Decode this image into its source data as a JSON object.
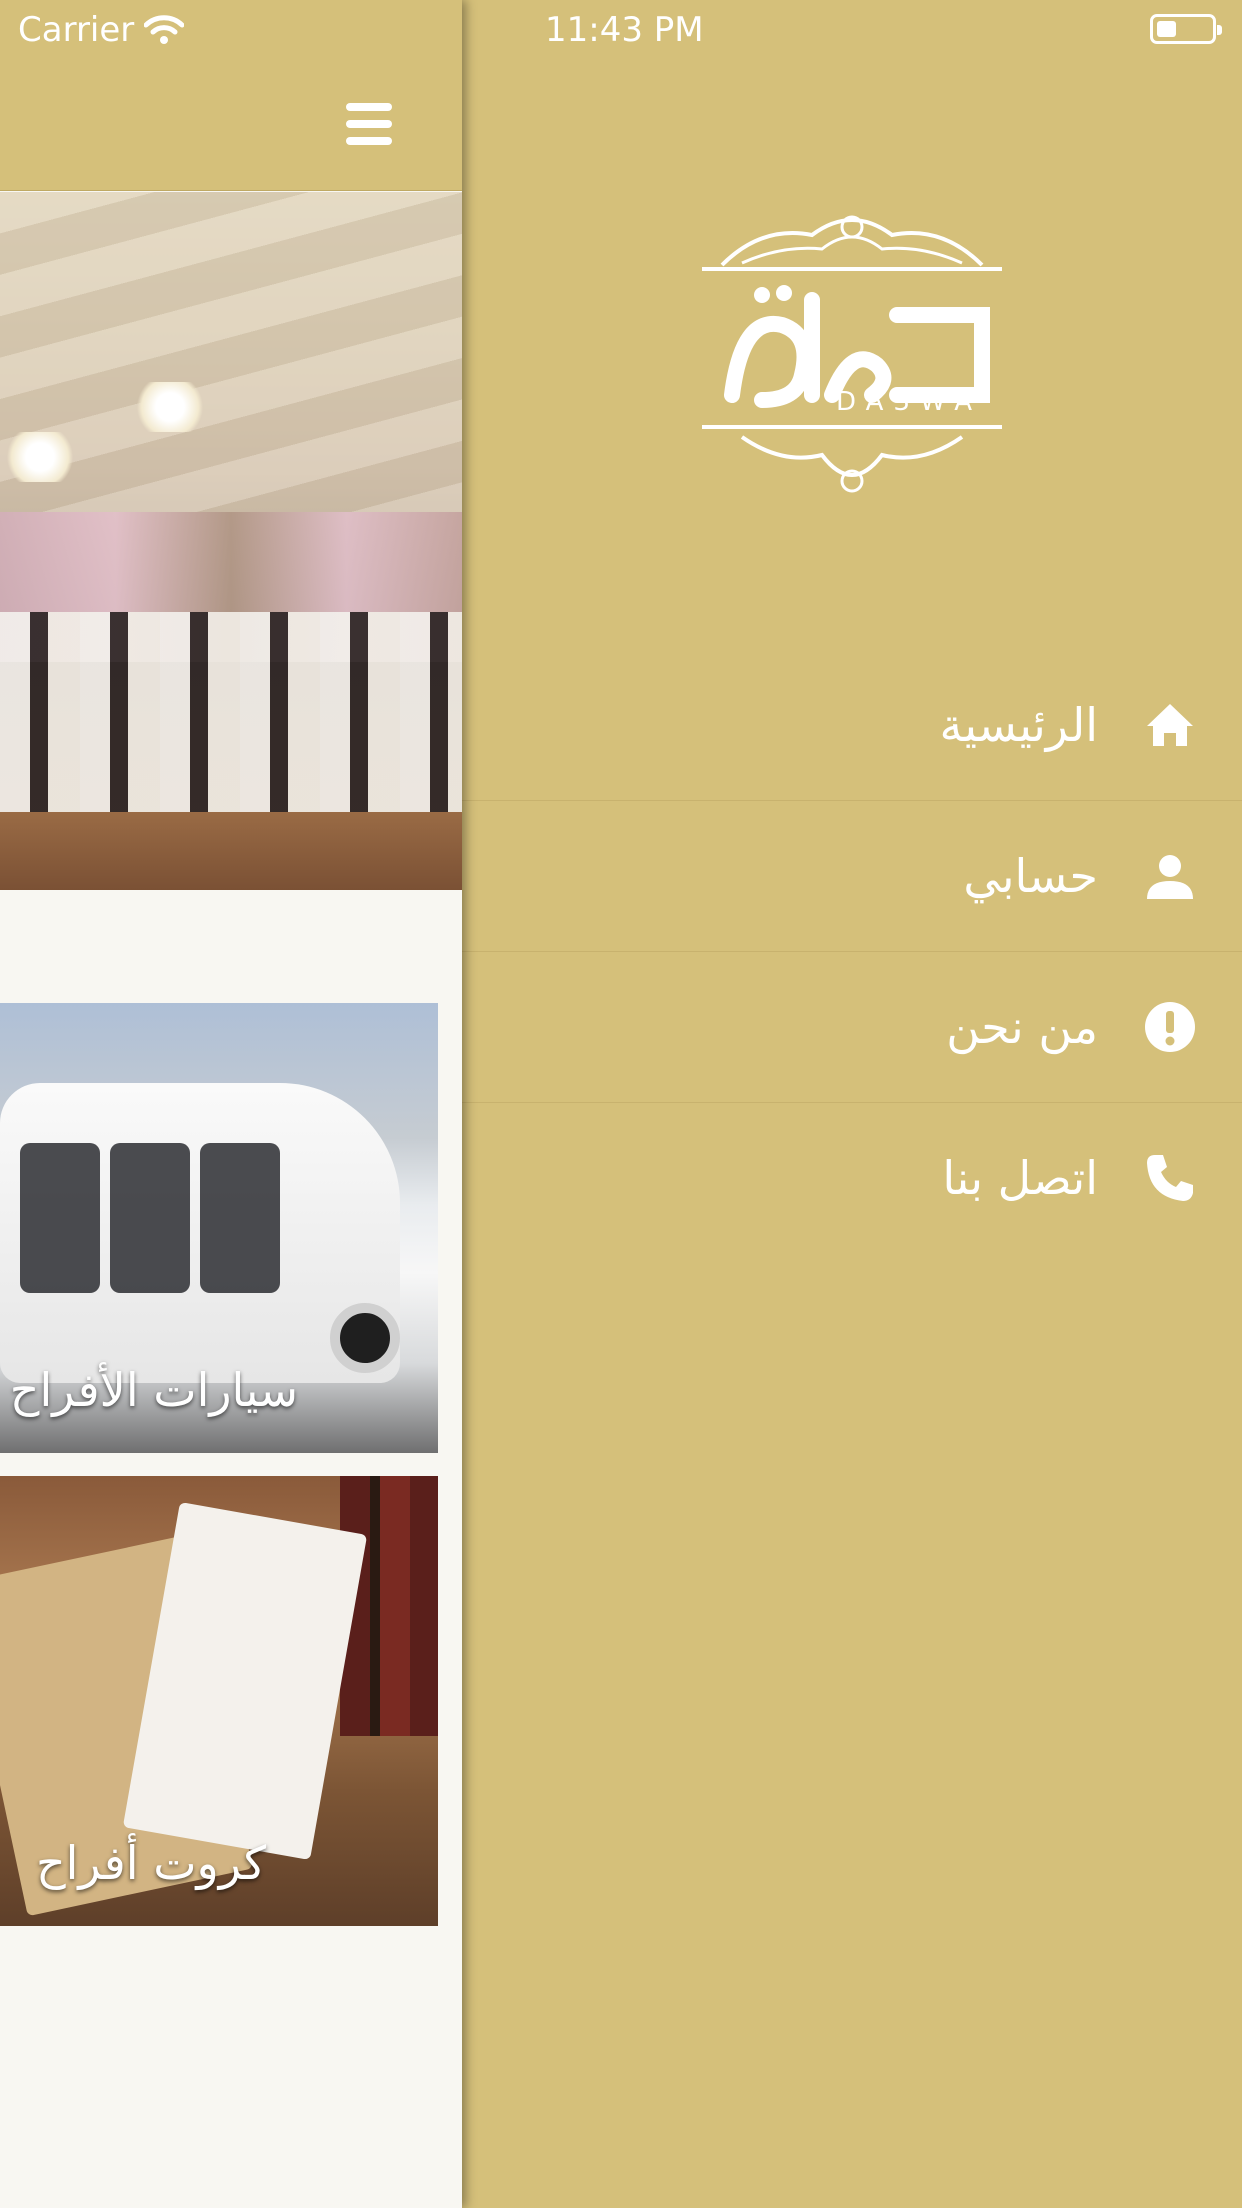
{
  "status_bar": {
    "carrier": "Carrier",
    "time": "11:43 PM",
    "battery_level": 0.35
  },
  "header": {
    "menu_icon": "hamburger-icon"
  },
  "content": {
    "cards": [
      {
        "label": "سيارات الأفراح"
      },
      {
        "label": "كروت أفراح"
      }
    ]
  },
  "menu": {
    "logo_text": "DA3WA",
    "items": [
      {
        "label": "الرئيسية",
        "icon": "home-icon"
      },
      {
        "label": "حسابي",
        "icon": "user-icon"
      },
      {
        "label": "من نحن",
        "icon": "info-icon"
      },
      {
        "label": "اتصل بنا",
        "icon": "phone-icon"
      }
    ]
  },
  "colors": {
    "gold": "#d5c07a",
    "white": "#ffffff",
    "content_bg": "#f8f7f2"
  }
}
